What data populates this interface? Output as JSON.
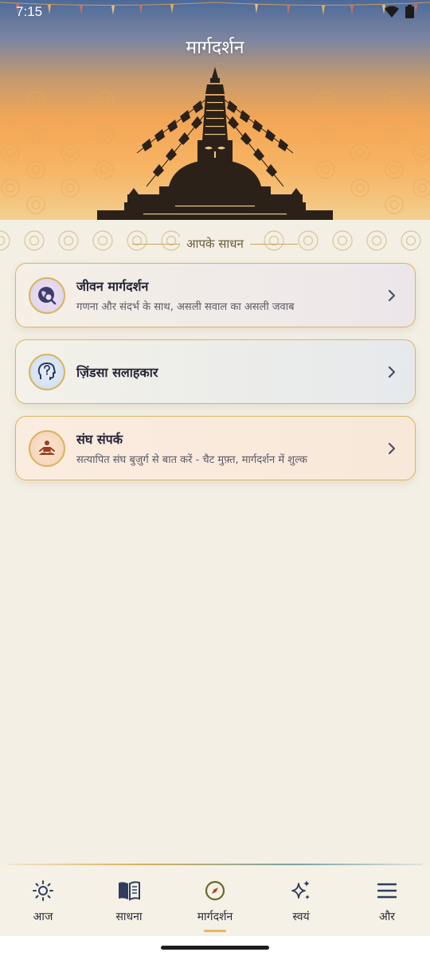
{
  "status_bar": {
    "time": "7:15"
  },
  "header": {
    "title": "मार्गदर्शन"
  },
  "section": {
    "label": "आपके साधन"
  },
  "cards": [
    {
      "title": "जीवन मार्गदर्शन",
      "subtitle": "गणना और संदर्भ के साथ, असली सवाल का असली जवाब",
      "icon": "globe-search-icon"
    },
    {
      "title": "ज़िंडसा सलाहकार",
      "subtitle": "",
      "icon": "head-question-icon"
    },
    {
      "title": "संघ संपर्क",
      "subtitle": "सत्यापित संघ बुज़ुर्ग से बात करें - चैट मुफ़्त, मार्गदर्शन में शुल्क",
      "icon": "meditation-icon"
    }
  ],
  "nav": {
    "items": [
      {
        "label": "आज",
        "icon": "sun-icon"
      },
      {
        "label": "साधना",
        "icon": "book-icon"
      },
      {
        "label": "मार्गदर्शन",
        "icon": "compass-icon",
        "active": true
      },
      {
        "label": "स्वयं",
        "icon": "sparkle-icon"
      },
      {
        "label": "और",
        "icon": "menu-icon"
      }
    ]
  },
  "colors": {
    "accent_gold": "#d9b45e",
    "background": "#f3efe4",
    "header_top": "#4c6a9a",
    "header_bottom": "#f2cf90"
  }
}
